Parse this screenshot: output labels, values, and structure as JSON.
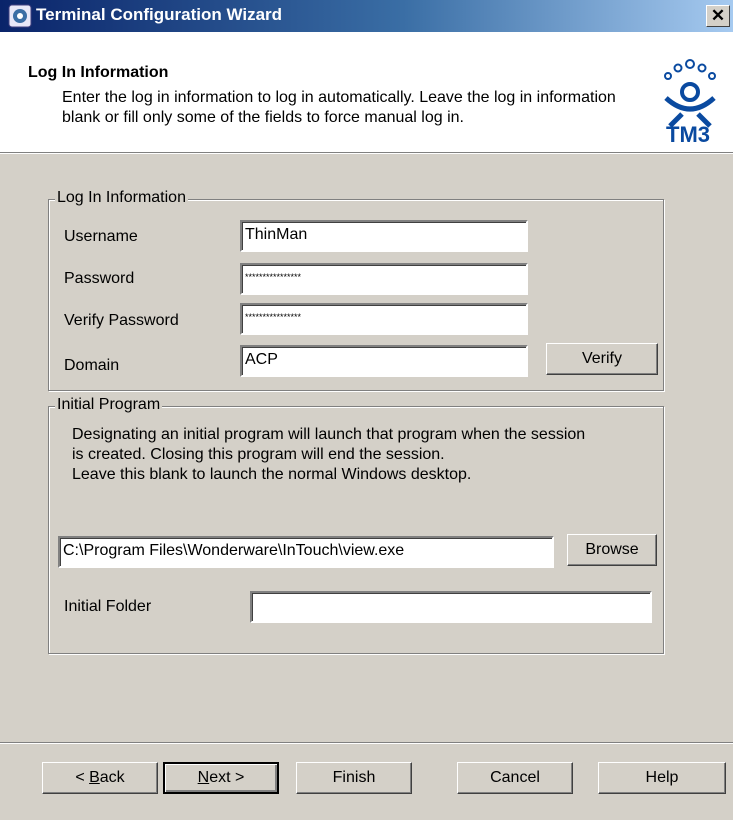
{
  "window": {
    "title": "Terminal Configuration Wizard",
    "close_glyph": "✕",
    "icon": "wizard-app-icon"
  },
  "header": {
    "title": "Log In Information",
    "description": "Enter the log in information to log in automatically. Leave the log in information blank or fill only some of the fields to force manual log in.",
    "logo": "TM3"
  },
  "login_group": {
    "label": "Log In Information",
    "username_label": "Username",
    "username_value": "ThinMan",
    "password_label": "Password",
    "password_value": "****************",
    "verify_password_label": "Verify Password",
    "verify_password_value": "****************",
    "domain_label": "Domain",
    "domain_value": "ACP",
    "verify_button": "Verify"
  },
  "program_group": {
    "label": "Initial Program",
    "line1": "Designating an initial program will launch that program when the session",
    "line2": "is created. Closing this program will end the session.",
    "line3": "Leave this blank to launch the normal Windows desktop.",
    "program_value": "C:\\Program Files\\Wonderware\\InTouch\\view.exe",
    "browse_button": "Browse",
    "folder_label": "Initial Folder",
    "folder_value": ""
  },
  "footer": {
    "back_pre": "< ",
    "back_key": "B",
    "back_post": "ack",
    "next_key": "N",
    "next_post": "ext >",
    "finish": "Finish",
    "cancel": "Cancel",
    "help": "Help"
  }
}
